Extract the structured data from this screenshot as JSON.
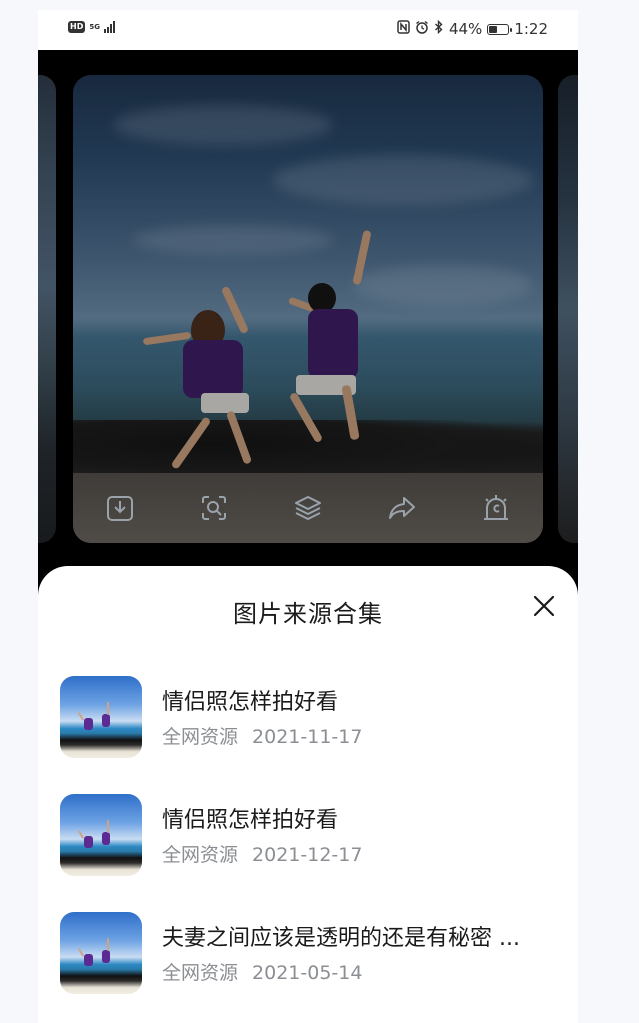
{
  "status_bar": {
    "hd": "HD",
    "network": "5G",
    "battery_percent": "44%",
    "battery_level": 0.44,
    "time": "1:22",
    "icons": [
      "nfc-icon",
      "alarm-icon",
      "bluetooth-icon"
    ]
  },
  "viewer": {
    "toolbar_icons": [
      "download-icon",
      "scan-icon",
      "layers-icon",
      "share-icon",
      "alert-icon"
    ]
  },
  "sheet": {
    "title": "图片来源合集",
    "close_icon": "close-icon",
    "results": [
      {
        "title": "情侣照怎样拍好看",
        "source": "全网资源",
        "date": "2021-11-17"
      },
      {
        "title": "情侣照怎样拍好看",
        "source": "全网资源",
        "date": "2021-12-17"
      },
      {
        "title": "夫妻之间应该是透明的还是有秘密 ...",
        "source": "全网资源",
        "date": "2021-05-14"
      }
    ]
  }
}
